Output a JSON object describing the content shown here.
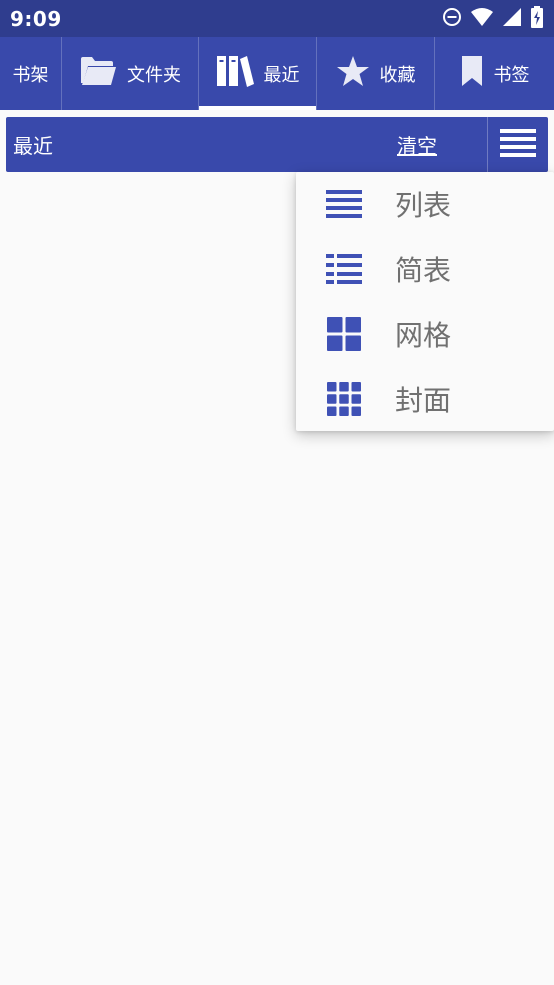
{
  "status_bar": {
    "time": "9:09",
    "icons": [
      "do-not-disturb-icon",
      "wifi-icon",
      "signal-icon",
      "battery-charging-icon"
    ]
  },
  "tabs": [
    {
      "label": "书架",
      "icon": null,
      "active": false
    },
    {
      "label": "文件夹",
      "icon": "folder-icon",
      "active": false
    },
    {
      "label": "最近",
      "icon": "books-icon",
      "active": true
    },
    {
      "label": "收藏",
      "icon": "star-icon",
      "active": false
    },
    {
      "label": "书签",
      "icon": "bookmark-icon",
      "active": false
    }
  ],
  "toolbar": {
    "title": "最近",
    "clear_label": "清空",
    "menu_icon": "hamburger-menu-icon"
  },
  "view_menu": {
    "items": [
      {
        "label": "列表",
        "icon": "list-view-icon"
      },
      {
        "label": "简表",
        "icon": "compact-list-icon"
      },
      {
        "label": "网格",
        "icon": "grid-view-icon"
      },
      {
        "label": "封面",
        "icon": "cover-grid-icon"
      }
    ]
  },
  "colors": {
    "status_bar": "#2f3d8e",
    "primary": "#3949ab",
    "background": "#fafafa",
    "menu_icon": "#3f51b5",
    "menu_text": "#707070"
  }
}
